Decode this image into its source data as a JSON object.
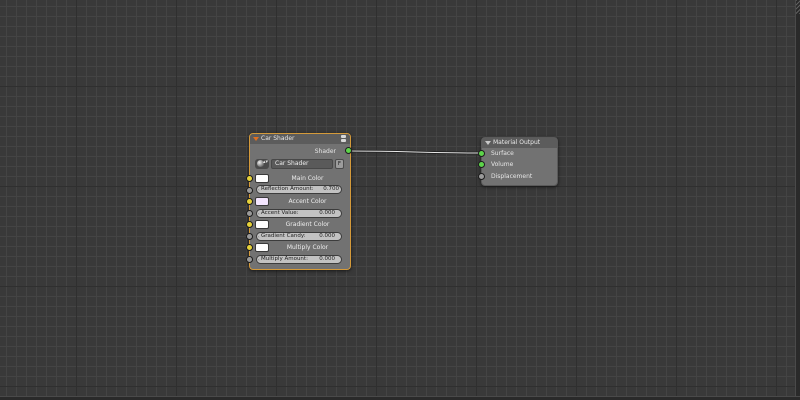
{
  "car_shader_node": {
    "title": "Car Shader",
    "output_label": "Shader",
    "group_name": "Car Shader",
    "group_fake_user": "F",
    "group_menu_arrows": "▴▾",
    "main_color_label": "Main Color",
    "reflection_label": "Reflection Amount:",
    "reflection_value": "0.700",
    "accent_color_label": "Accent Color",
    "accent_value_label": "Accent Value:",
    "accent_value": "0.000",
    "gradient_color_label": "Gradient Color",
    "gradient_candy_label": "Gradient Candy:",
    "gradient_candy_value": "0.000",
    "multiply_color_label": "Multiply Color",
    "multiply_amount_label": "Multiply Amount:",
    "multiply_amount_value": "0.000",
    "colors": {
      "main": "#ffffff",
      "accent": "#f4e6ff",
      "gradient": "#ffffff",
      "multiply": "#ffffff",
      "border": "#d49a3a"
    }
  },
  "material_output_node": {
    "title": "Material Output",
    "inputs": [
      "Surface",
      "Volume",
      "Displacement"
    ]
  },
  "link": {
    "from": "Shader",
    "to": "Surface"
  },
  "socket_colors": {
    "shader": "#5dd44a",
    "color": "#e6d23a",
    "value": "#9a9a9a"
  }
}
